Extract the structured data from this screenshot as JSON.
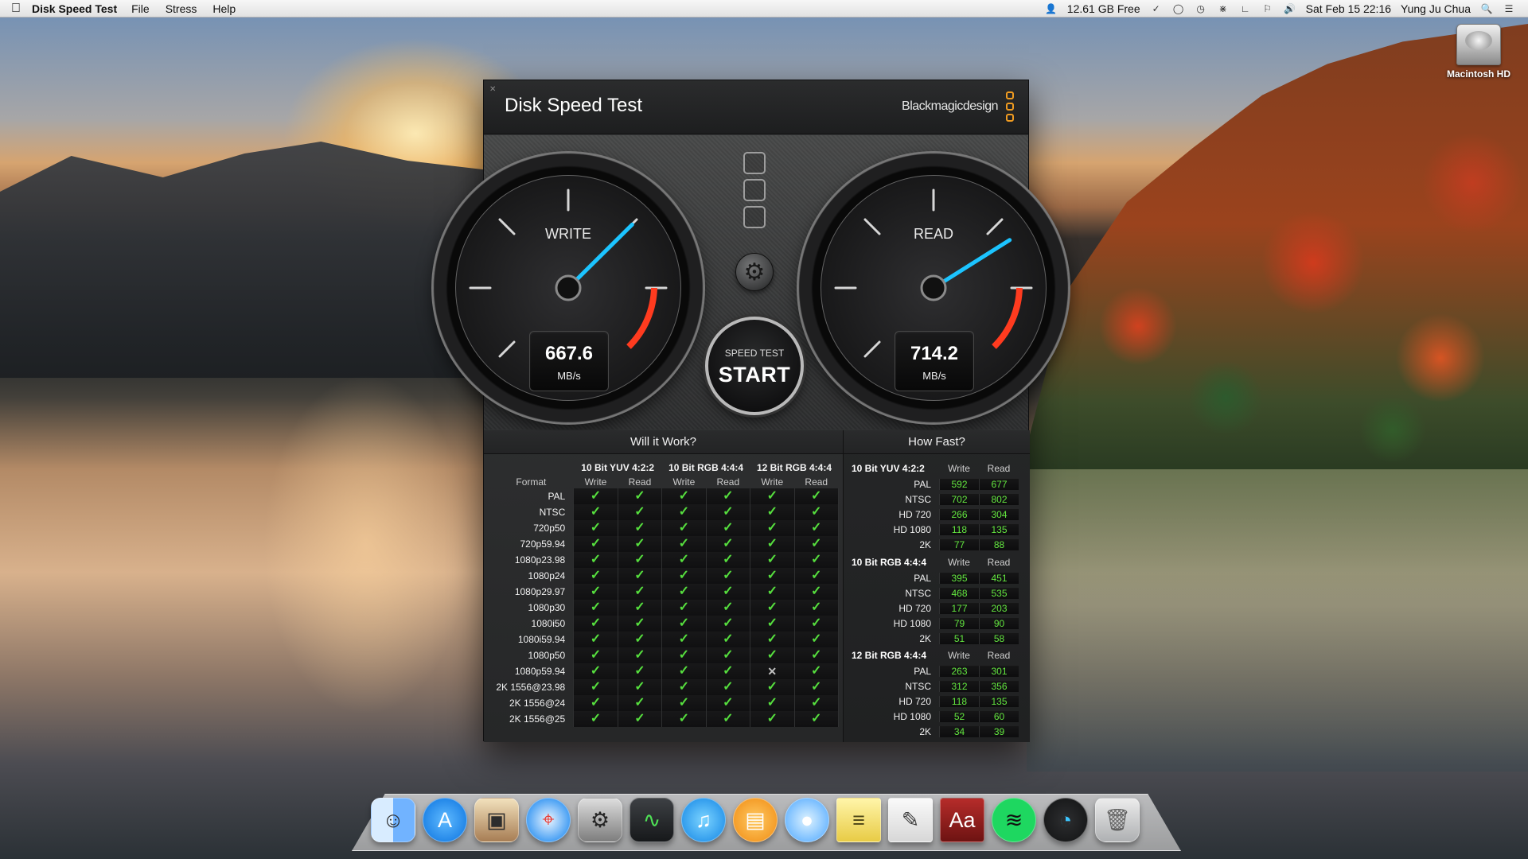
{
  "menubar": {
    "app_name": "Disk Speed Test",
    "menus": [
      "File",
      "Stress",
      "Help"
    ],
    "right": {
      "disk_free": "12.61 GB Free",
      "datetime": "Sat Feb 15  22:16",
      "user": "Yung Ju Chua"
    }
  },
  "desktop": {
    "drive_label": "Macintosh HD"
  },
  "window": {
    "title": "Disk Speed Test",
    "brand": "Blackmagicdesign",
    "write": {
      "label": "WRITE",
      "value": "667.6",
      "unit": "MB/s",
      "needle_mbps": 667.6
    },
    "read": {
      "label": "READ",
      "value": "714.2",
      "unit": "MB/s",
      "needle_mbps": 714.2
    },
    "start": {
      "caption": "SPEED TEST",
      "label": "START"
    },
    "will_it_work": {
      "title": "Will it Work?",
      "format_label": "Format",
      "groups": [
        "10 Bit YUV 4:2:2",
        "10 Bit RGB 4:4:4",
        "12 Bit RGB 4:4:4"
      ],
      "subheaders": [
        "Write",
        "Read",
        "Write",
        "Read",
        "Write",
        "Read"
      ],
      "rows": [
        {
          "format": "PAL",
          "checks": [
            1,
            1,
            1,
            1,
            1,
            1
          ]
        },
        {
          "format": "NTSC",
          "checks": [
            1,
            1,
            1,
            1,
            1,
            1
          ]
        },
        {
          "format": "720p50",
          "checks": [
            1,
            1,
            1,
            1,
            1,
            1
          ]
        },
        {
          "format": "720p59.94",
          "checks": [
            1,
            1,
            1,
            1,
            1,
            1
          ]
        },
        {
          "format": "1080p23.98",
          "checks": [
            1,
            1,
            1,
            1,
            1,
            1
          ]
        },
        {
          "format": "1080p24",
          "checks": [
            1,
            1,
            1,
            1,
            1,
            1
          ]
        },
        {
          "format": "1080p29.97",
          "checks": [
            1,
            1,
            1,
            1,
            1,
            1
          ]
        },
        {
          "format": "1080p30",
          "checks": [
            1,
            1,
            1,
            1,
            1,
            1
          ]
        },
        {
          "format": "1080i50",
          "checks": [
            1,
            1,
            1,
            1,
            1,
            1
          ]
        },
        {
          "format": "1080i59.94",
          "checks": [
            1,
            1,
            1,
            1,
            1,
            1
          ]
        },
        {
          "format": "1080p50",
          "checks": [
            1,
            1,
            1,
            1,
            1,
            1
          ]
        },
        {
          "format": "1080p59.94",
          "checks": [
            1,
            1,
            1,
            1,
            0,
            1
          ]
        },
        {
          "format": "2K 1556@23.98",
          "checks": [
            1,
            1,
            1,
            1,
            1,
            1
          ]
        },
        {
          "format": "2K 1556@24",
          "checks": [
            1,
            1,
            1,
            1,
            1,
            1
          ]
        },
        {
          "format": "2K 1556@25",
          "checks": [
            1,
            1,
            1,
            1,
            1,
            1
          ]
        }
      ]
    },
    "how_fast": {
      "title": "How Fast?",
      "groups": [
        {
          "name": "10 Bit YUV 4:2:2",
          "cols": [
            "Write",
            "Read"
          ],
          "rows": [
            {
              "label": "PAL",
              "write": "592",
              "read": "677"
            },
            {
              "label": "NTSC",
              "write": "702",
              "read": "802"
            },
            {
              "label": "HD 720",
              "write": "266",
              "read": "304"
            },
            {
              "label": "HD 1080",
              "write": "118",
              "read": "135"
            },
            {
              "label": "2K",
              "write": "77",
              "read": "88"
            }
          ]
        },
        {
          "name": "10 Bit RGB 4:4:4",
          "cols": [
            "Write",
            "Read"
          ],
          "rows": [
            {
              "label": "PAL",
              "write": "395",
              "read": "451"
            },
            {
              "label": "NTSC",
              "write": "468",
              "read": "535"
            },
            {
              "label": "HD 720",
              "write": "177",
              "read": "203"
            },
            {
              "label": "HD 1080",
              "write": "79",
              "read": "90"
            },
            {
              "label": "2K",
              "write": "51",
              "read": "58"
            }
          ]
        },
        {
          "name": "12 Bit RGB 4:4:4",
          "cols": [
            "Write",
            "Read"
          ],
          "rows": [
            {
              "label": "PAL",
              "write": "263",
              "read": "301"
            },
            {
              "label": "NTSC",
              "write": "312",
              "read": "356"
            },
            {
              "label": "HD 720",
              "write": "118",
              "read": "135"
            },
            {
              "label": "HD 1080",
              "write": "52",
              "read": "60"
            },
            {
              "label": "2K",
              "write": "34",
              "read": "39"
            }
          ]
        }
      ]
    }
  },
  "dock": {
    "icons": [
      "finder-icon",
      "app-store-icon",
      "preview-icon",
      "safari-icon",
      "system-preferences-icon",
      "activity-monitor-icon",
      "itunes-icon",
      "ibooks-icon",
      "messages-icon",
      "stickies-icon",
      "textedit-icon",
      "dictionary-icon",
      "spotify-icon",
      "disk-speed-test-icon",
      "trash-icon"
    ]
  },
  "colors": {
    "accent_check": "#56df3e",
    "needle": "#1cc4ff",
    "gauge_red": "#ff3b1f"
  }
}
